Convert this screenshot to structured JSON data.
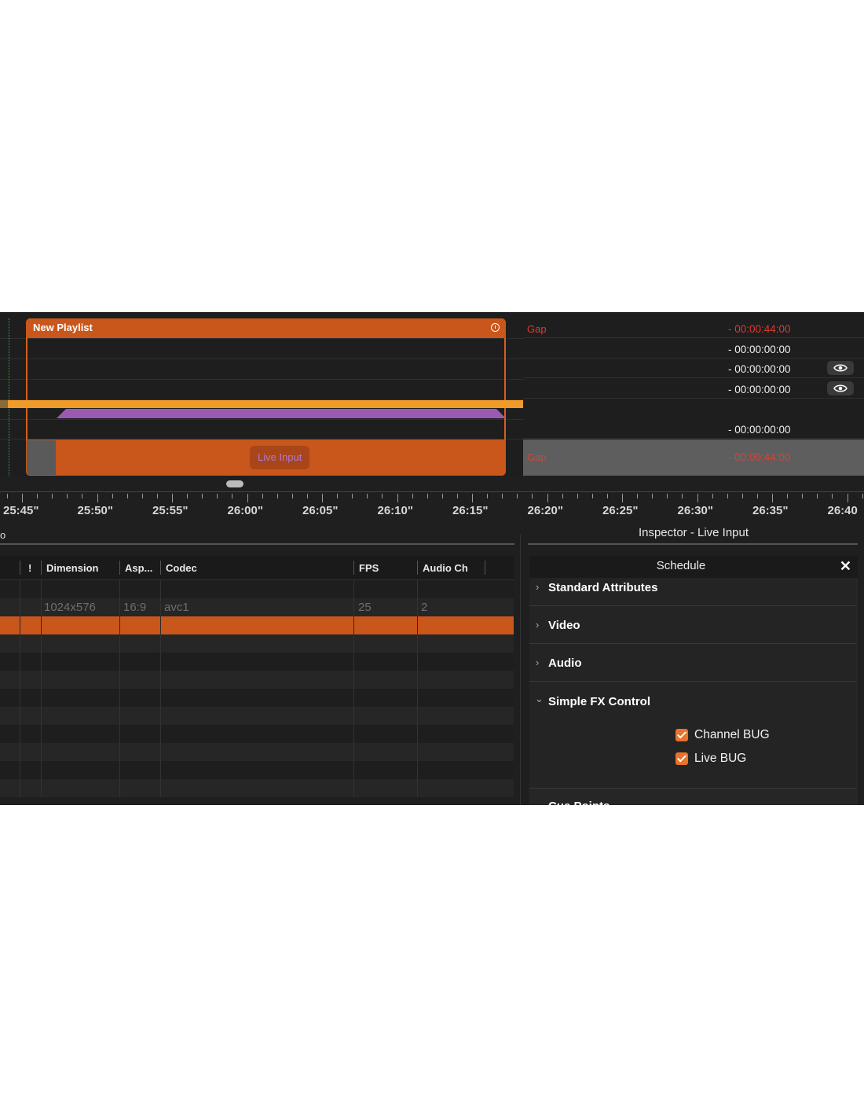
{
  "timeline": {
    "playlist_title": "New Playlist",
    "clip_label": "Live Input",
    "colors": {
      "clip": "#c9561a",
      "bar": "#f09a2a",
      "transition": "#9a5ab0"
    }
  },
  "right_panel": {
    "rows": [
      {
        "name": "Gap",
        "time": "- 00:00:44:00",
        "time_red": true,
        "eye": false
      },
      {
        "name": "",
        "time": "- 00:00:00:00",
        "time_red": false,
        "eye": false
      },
      {
        "name": "",
        "time": "- 00:00:00:00",
        "time_red": false,
        "eye": true
      },
      {
        "name": "",
        "time": "- 00:00:00:00",
        "time_red": false,
        "eye": true
      },
      {
        "name": "",
        "time": "",
        "time_red": false,
        "eye": false
      },
      {
        "name": "",
        "time": "- 00:00:00:00",
        "time_red": false,
        "eye": false
      }
    ],
    "last": {
      "name": "Gap",
      "time": "- 00:00:44:00"
    }
  },
  "ruler": {
    "labels": [
      "25:45\"",
      "25:50\"",
      "25:55\"",
      "26:00\"",
      "26:05\"",
      "26:10\"",
      "26:15\"",
      "26:20\"",
      "26:25\"",
      "26:30\"",
      "26:35\"",
      "26:40"
    ]
  },
  "table": {
    "edge_glyph": "o",
    "headers": [
      "!",
      "Dimension",
      "Asp...",
      "Codec",
      "FPS",
      "Audio Ch"
    ],
    "row": {
      "dimension": "1024x576",
      "aspect": "16:9",
      "codec": "avc1",
      "fps": "25",
      "audio": "2"
    }
  },
  "inspector": {
    "title": "Inspector - Live Input",
    "tab": "Schedule",
    "sections": [
      {
        "title": "Standard Attributes",
        "expanded": false
      },
      {
        "title": "Video",
        "expanded": false
      },
      {
        "title": "Audio",
        "expanded": false
      },
      {
        "title": "Simple FX Control",
        "expanded": true
      }
    ],
    "checkboxes": [
      {
        "label": "Channel BUG",
        "checked": true
      },
      {
        "label": "Live BUG",
        "checked": true
      }
    ],
    "next_section_peek": "Cue Points"
  }
}
